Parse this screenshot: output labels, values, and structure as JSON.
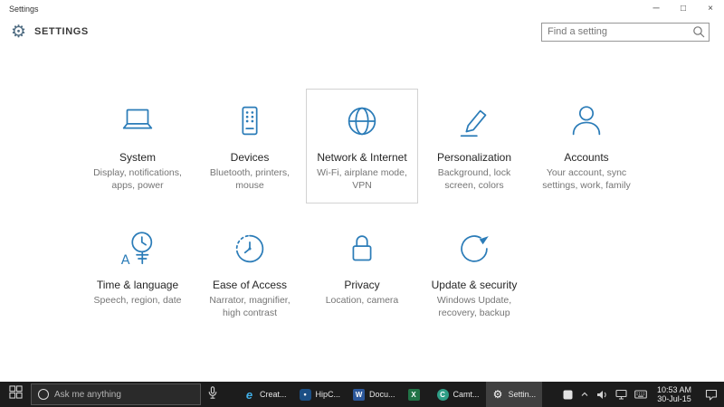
{
  "colors": {
    "accent": "#2b7cb8",
    "taskbar_bg": "#1c1c1c",
    "highlight_border": "#d2d2d2"
  },
  "window": {
    "title": "Settings",
    "controls": {
      "minimize": "─",
      "maximize": "□",
      "close": "×"
    }
  },
  "header": {
    "gear_glyph": "⚙",
    "title": "SETTINGS",
    "search_placeholder": "Find a setting"
  },
  "categories": [
    {
      "name": "System",
      "desc": "Display, notifications, apps, power",
      "icon": "laptop-icon"
    },
    {
      "name": "Devices",
      "desc": "Bluetooth, printers, mouse",
      "icon": "devices-icon"
    },
    {
      "name": "Network & Internet",
      "desc": "Wi-Fi, airplane mode, VPN",
      "icon": "globe-icon",
      "highlighted": true
    },
    {
      "name": "Personalization",
      "desc": "Background, lock screen, colors",
      "icon": "pen-icon"
    },
    {
      "name": "Accounts",
      "desc": "Your account, sync settings, work, family",
      "icon": "person-icon"
    },
    {
      "name": "Time & language",
      "desc": "Speech, region, date",
      "icon": "clock-language-icon"
    },
    {
      "name": "Ease of Access",
      "desc": "Narrator, magnifier, high contrast",
      "icon": "ease-of-access-icon"
    },
    {
      "name": "Privacy",
      "desc": "Location, camera",
      "icon": "lock-icon"
    },
    {
      "name": "Update & security",
      "desc": "Windows Update, recovery, backup",
      "icon": "refresh-icon"
    }
  ],
  "taskbar": {
    "search_placeholder": "Ask me anything",
    "apps": [
      {
        "label": "Creat...",
        "glyph": "e",
        "icon": "edge-icon"
      },
      {
        "label": "HipC...",
        "glyph": "•",
        "icon": "hipchat-icon"
      },
      {
        "label": "Docu...",
        "glyph": "W",
        "icon": "word-icon"
      },
      {
        "label": "",
        "glyph": "X",
        "icon": "excel-icon"
      },
      {
        "label": "Camt...",
        "glyph": "C",
        "icon": "camtasia-icon"
      },
      {
        "label": "Settin...",
        "glyph": "⚙",
        "icon": "settings-icon",
        "active": true
      }
    ],
    "tray": {
      "time": "10:53 AM",
      "date": "30-Jul-15",
      "icons": [
        "tray-app-icon",
        "chevron-up-icon",
        "volume-icon",
        "network-icon",
        "keyboard-icon",
        "action-center-icon"
      ]
    }
  }
}
